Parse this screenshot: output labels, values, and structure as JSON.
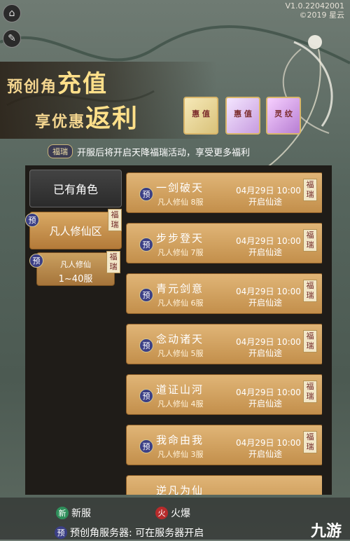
{
  "version": "V1.0.22042001",
  "copyright": "©2019 星云",
  "banner": {
    "line1_prefix": "预创角",
    "line1_big": "充值",
    "line2_prefix": "享优惠",
    "line2_big": "返利",
    "card_labels": [
      "惠\n值",
      "惠\n值",
      "灵\n纹"
    ]
  },
  "notice": {
    "tag": "福瑞",
    "text": "开服后将开启天降福瑞活动，享受更多福利"
  },
  "sidebar": {
    "existing_roles": "已有角色",
    "zone": "凡人修仙区",
    "sub_line1": "凡人修仙",
    "sub_line2": "1~40服",
    "badge_yu": "预",
    "badge_fu": "福瑞"
  },
  "servers": [
    {
      "name": "一剑破天",
      "group": "凡人修仙 8服",
      "date": "04月29日 10:00",
      "state": "开启仙途"
    },
    {
      "name": "步步登天",
      "group": "凡人修仙 7服",
      "date": "04月29日 10:00",
      "state": "开启仙途"
    },
    {
      "name": "青元剑意",
      "group": "凡人修仙 6服",
      "date": "04月29日 10:00",
      "state": "开启仙途"
    },
    {
      "name": "念动诸天",
      "group": "凡人修仙 5服",
      "date": "04月29日 10:00",
      "state": "开启仙途"
    },
    {
      "name": "道证山河",
      "group": "凡人修仙 4服",
      "date": "04月29日 10:00",
      "state": "开启仙途"
    },
    {
      "name": "我命由我",
      "group": "凡人修仙 3服",
      "date": "04月29日 10:00",
      "state": "开启仙途"
    },
    {
      "name": "逆凡为仙",
      "group": "",
      "date": "",
      "state": ""
    }
  ],
  "footer": {
    "new_badge": "新",
    "new_label": "新服",
    "hot_badge": "火",
    "hot_label": "火爆",
    "pre_badge": "预",
    "pre_label": "预创角服务器: 可在服务器开启",
    "logo": "九游"
  },
  "colors": {
    "accent": "#e0b577",
    "panel": "#1f1c18",
    "badge_blue": "#3b3f85"
  }
}
